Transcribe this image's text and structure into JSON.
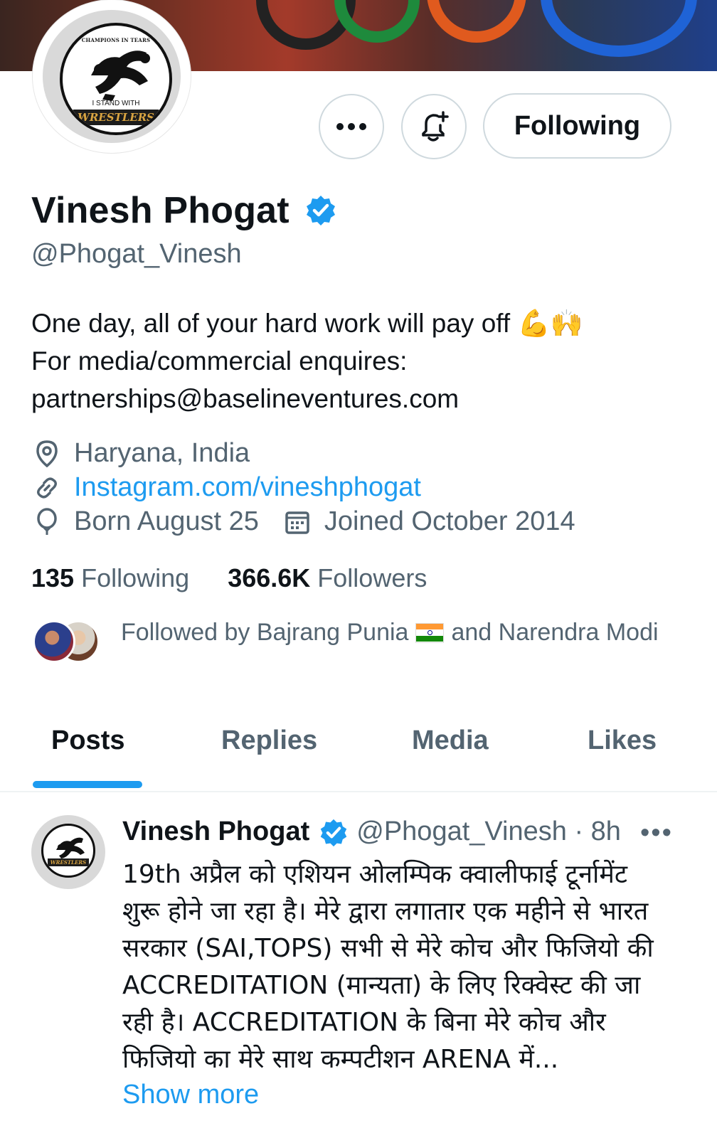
{
  "colors": {
    "accent": "#1d9bf0",
    "text": "#0f1419",
    "muted": "#536471",
    "border": "#cfd9de"
  },
  "avatar": {
    "top_text": "CHAMPIONS IN TEARS",
    "mid_text": "I STAND WITH",
    "banner_text": "WRESTLERS"
  },
  "actions": {
    "more_icon": "more-icon",
    "notify_icon": "bell-plus-icon",
    "following_label": "Following"
  },
  "profile": {
    "name": "Vinesh Phogat",
    "verified_icon": "verified-badge-icon",
    "handle": "@Phogat_Vinesh",
    "bio_line1": "One day, all of your hard work will pay off",
    "bio_emoji": "💪🙌",
    "bio_line2": "For media/commercial enquires:",
    "bio_line3": "partnerships@baselineventures.com",
    "location": "Haryana, India",
    "website": "Instagram.com/vineshphogat",
    "birthday": "Born August 25",
    "joined": "Joined October 2014"
  },
  "stats": {
    "following_count": "135",
    "following_label": "Following",
    "followers_count": "366.6K",
    "followers_label": "Followers"
  },
  "followed_by": {
    "prefix": "Followed by Bajrang Punia",
    "suffix": "and Narendra Modi"
  },
  "tabs": [
    {
      "label": "Posts",
      "active": true
    },
    {
      "label": "Replies",
      "active": false
    },
    {
      "label": "Media",
      "active": false
    },
    {
      "label": "Likes",
      "active": false
    }
  ],
  "post": {
    "author": "Vinesh Phogat",
    "handle_time": "@Phogat_Vinesh · 8h",
    "more": "•••",
    "lines": [
      "19th अप्रैल को एशियन ओलम्पिक क्वालीफाई टूर्नामेंट",
      "शुरू होने जा रहा है। मेरे द्वारा लगातार एक महीने से भारत",
      "सरकार (SAI,TOPS) सभी से मेरे कोच और फिजियो की",
      "ACCREDITATION (मान्यता)  के लिए रिक्वेस्ट की जा",
      "रही है। ACCREDITATION के बिना मेरे कोच और",
      "फिजियो का मेरे साथ कम्पटीशन ARENA में..."
    ],
    "show_more": "Show more"
  }
}
